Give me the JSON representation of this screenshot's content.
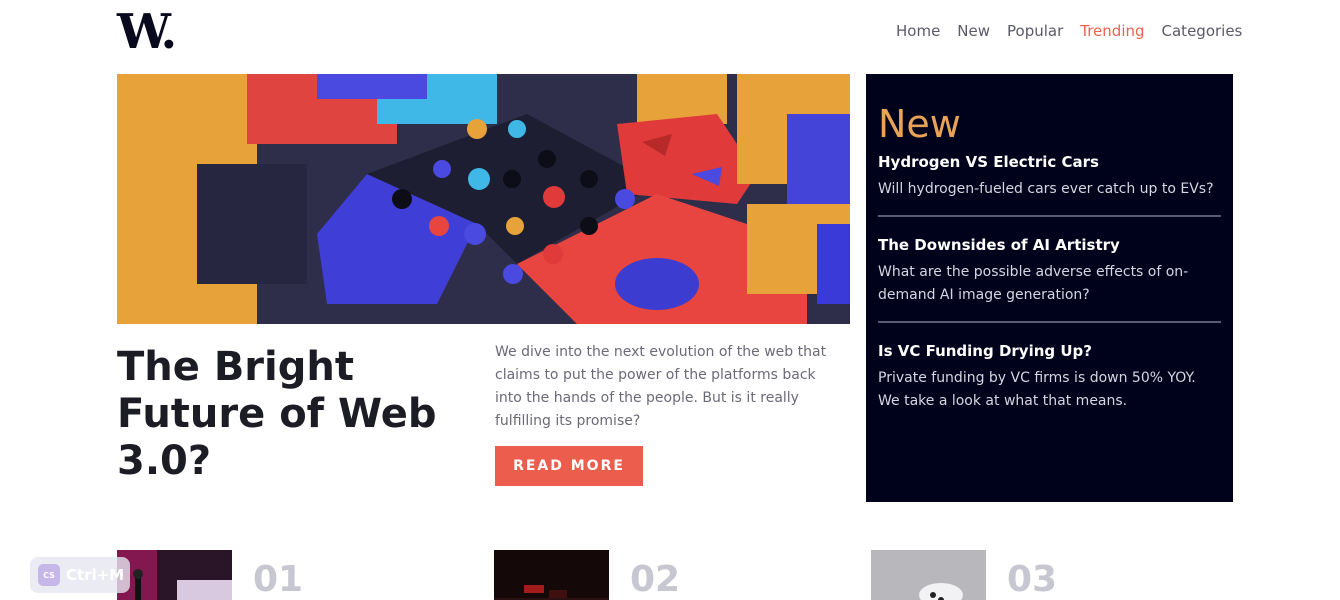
{
  "logo": {
    "letter": "W",
    "dot": "."
  },
  "nav": {
    "items": [
      "Home",
      "New",
      "Popular",
      "Trending",
      "Categories"
    ],
    "active": "Trending"
  },
  "hero": {
    "title": "The Bright Future of Web 3.0?",
    "description": "We dive into the next evolution of the web that claims to put the power of the platforms back into the hands of the people. But is it really fulfilling its promise?",
    "cta": "READ MORE"
  },
  "new_panel": {
    "heading": "New",
    "items": [
      {
        "title": "Hydrogen VS Electric Cars",
        "desc": "Will hydrogen-fueled cars ever catch up to EVs?"
      },
      {
        "title": "The Downsides of AI Artistry",
        "desc": "What are the possible adverse effects of on-demand AI image generation?"
      },
      {
        "title": "Is VC Funding Drying Up?",
        "desc": "Private funding by VC firms is down 50% YOY. We take a look at what that means."
      }
    ]
  },
  "numbered": [
    {
      "num": "01",
      "image": "gaming-setup-thumbnail"
    },
    {
      "num": "02",
      "image": "keyboard-thumbnail"
    },
    {
      "num": "03",
      "image": "vr-controller-thumbnail"
    }
  ],
  "overlay": {
    "text": "Ctrl+M",
    "icon": "CS"
  },
  "colors": {
    "accent": "#ec5d4d",
    "panel_bg": "#00011a",
    "new_heading": "#e9a356",
    "nav_active": "#e9634f"
  }
}
